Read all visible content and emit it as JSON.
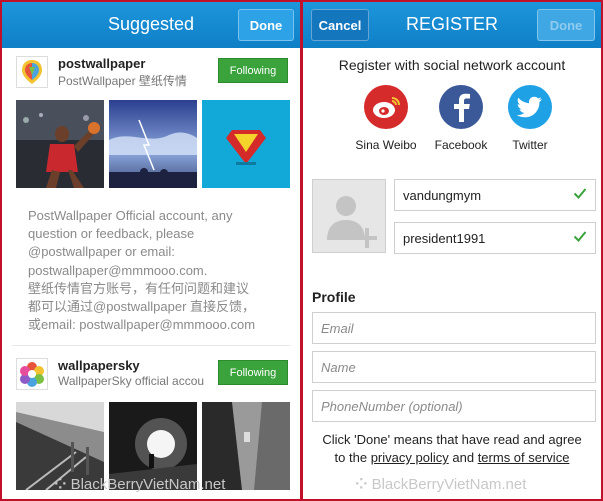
{
  "left": {
    "header": {
      "title": "Suggested",
      "done_label": "Done"
    },
    "accounts": [
      {
        "name": "postwallpaper",
        "subtitle": "PostWallpaper 壁纸传情",
        "follow_label": "Following",
        "description": [
          "PostWallpaper Official account, any",
          "question or feedback, please",
          "@postwallpaper or email:",
          "postwallpaper@mmmooo.com.",
          "壁纸传情官方账号，有任何问题和建议",
          "都可以通过@postwallpaper 直接反馈，",
          "或email: postwallpaper@mmmooo.com"
        ]
      },
      {
        "name": "wallpapersky",
        "subtitle": "WallpaperSky official accou",
        "follow_label": "Following"
      }
    ],
    "watermark": "BlackBerryVietNam.net"
  },
  "right": {
    "header": {
      "cancel_label": "Cancel",
      "title": "REGISTER",
      "done_label": "Done"
    },
    "subtitle": "Register with social network account",
    "social": [
      {
        "label": "Sina Weibo",
        "icon": "sina-weibo-icon",
        "color": "#d52b2b"
      },
      {
        "label": "Facebook",
        "icon": "facebook-icon",
        "color": "#3b5998"
      },
      {
        "label": "Twitter",
        "icon": "twitter-icon",
        "color": "#1fa1e6"
      }
    ],
    "username": "vandungmym",
    "password": "president1991",
    "profile_heading": "Profile",
    "placeholders": {
      "email": "Email",
      "name": "Name",
      "phone": "PhoneNumber (optional)"
    },
    "tos": {
      "line1": "Click 'Done' means that have read and agree",
      "to_the": "to the",
      "privacy": "privacy policy",
      "and": "and",
      "terms": "terms of service"
    },
    "watermark": "BlackBerryVietNam.net"
  },
  "colors": {
    "header_blue": "#1587d0",
    "following_green": "#3aa33c",
    "check_green": "#3aa33c",
    "border_red": "#c0102a"
  }
}
